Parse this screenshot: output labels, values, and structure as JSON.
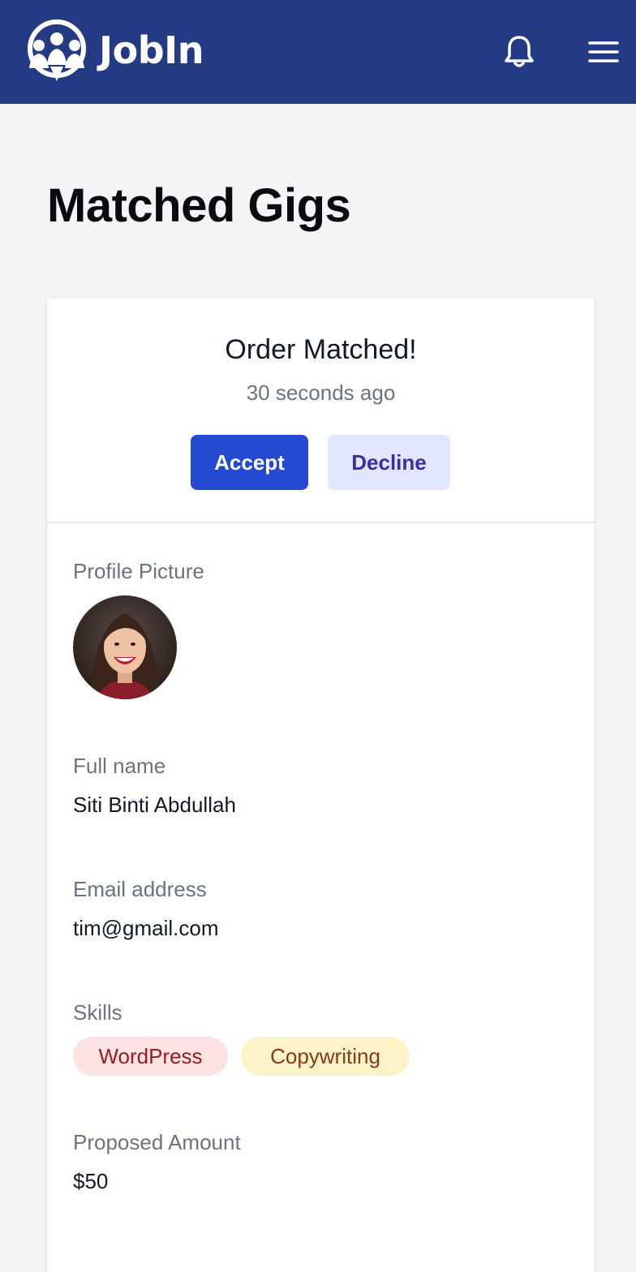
{
  "navbar": {
    "brand": "JobIn",
    "background": "#253a85",
    "icons": [
      "bell-icon",
      "hamburger-menu-icon"
    ]
  },
  "page": {
    "title": "Matched Gigs"
  },
  "match": {
    "title": "Order Matched!",
    "time": "30 seconds ago",
    "accept_label": "Accept",
    "decline_label": "Decline",
    "accept_color": "#2549d1",
    "decline_color": "#e0e7ff"
  },
  "profile": {
    "picture_label": "Profile Picture",
    "name_label": "Full name",
    "name": "Siti Binti Abdullah",
    "email_label": "Email address",
    "email": "tim@gmail.com",
    "skills_label": "Skills",
    "skills": [
      "WordPress",
      "Copywriting"
    ],
    "amount_label": "Proposed Amount",
    "amount": "$50"
  }
}
